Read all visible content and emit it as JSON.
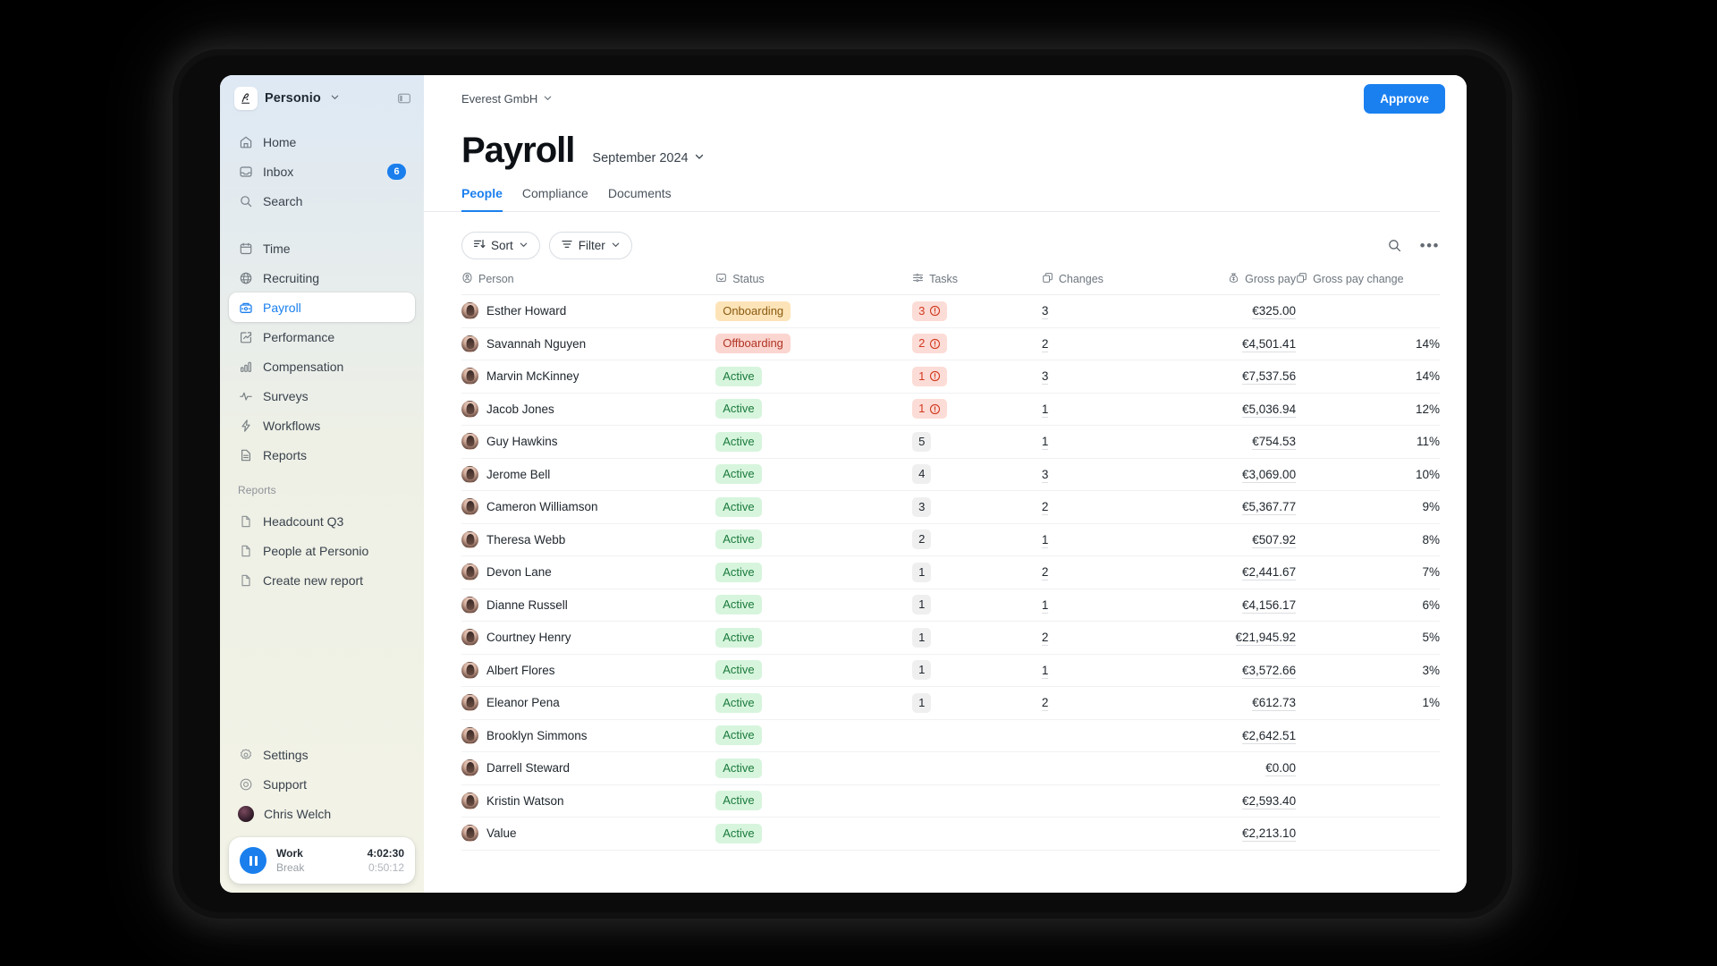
{
  "sidebar": {
    "brand": "Personio",
    "brand_logo_icon": "personio-p-logo-icon",
    "panel_toggle_icon": "panel-toggle-icon",
    "primary": [
      {
        "label": "Home",
        "icon": "home-icon"
      },
      {
        "label": "Inbox",
        "icon": "inbox-icon",
        "badge": "6"
      },
      {
        "label": "Search",
        "icon": "search-icon"
      }
    ],
    "modules": [
      {
        "label": "Time",
        "icon": "calendar-icon"
      },
      {
        "label": "Recruiting",
        "icon": "globe-icon"
      },
      {
        "label": "Payroll",
        "icon": "payroll-icon",
        "active": true
      },
      {
        "label": "Performance",
        "icon": "performance-icon"
      },
      {
        "label": "Compensation",
        "icon": "bar-chart-icon"
      },
      {
        "label": "Surveys",
        "icon": "pulse-icon"
      },
      {
        "label": "Workflows",
        "icon": "bolt-icon"
      },
      {
        "label": "Reports",
        "icon": "document-icon"
      }
    ],
    "reports_label": "Reports",
    "reports": [
      {
        "label": "Headcount Q3",
        "icon": "file-icon"
      },
      {
        "label": "People at Personio",
        "icon": "file-icon"
      },
      {
        "label": "Create new report",
        "icon": "file-icon"
      }
    ],
    "footer": [
      {
        "label": "Settings",
        "icon": "gear-icon"
      },
      {
        "label": "Support",
        "icon": "lifebuoy-icon"
      },
      {
        "label": "Chris Welch",
        "icon": "avatar"
      }
    ],
    "timer": {
      "play_pause_icon": "pause-icon",
      "work_label": "Work",
      "work_time": "4:02:30",
      "break_label": "Break",
      "break_time": "0:50:12"
    }
  },
  "header": {
    "org": "Everest GmbH",
    "org_chevron_icon": "chevron-down-icon",
    "approve_label": "Approve",
    "title": "Payroll",
    "period": "September 2024",
    "period_chevron_icon": "chevron-down-icon",
    "tabs": [
      {
        "label": "People",
        "active": true
      },
      {
        "label": "Compliance",
        "active": false
      },
      {
        "label": "Documents",
        "active": false
      }
    ]
  },
  "toolbar": {
    "sort_label": "Sort",
    "sort_icon": "sort-icon",
    "filter_label": "Filter",
    "filter_icon": "filter-icon",
    "search_icon": "search-icon",
    "more_icon": "more-horizontal-icon"
  },
  "table": {
    "columns": [
      {
        "label": "Person",
        "icon": "person-icon",
        "align": "left"
      },
      {
        "label": "Status",
        "icon": "status-icon",
        "align": "left"
      },
      {
        "label": "Tasks",
        "icon": "tasks-icon",
        "align": "left"
      },
      {
        "label": "Changes",
        "icon": "copy-icon",
        "align": "left"
      },
      {
        "label": "Gross pay",
        "icon": "money-bag-icon",
        "align": "right"
      },
      {
        "label": "Gross pay change",
        "icon": "copy-icon",
        "align": "left"
      }
    ],
    "rows": [
      {
        "person": "Esther Howard",
        "status": "Onboarding",
        "status_kind": "onboarding",
        "tasks": "3",
        "tasks_alert": true,
        "changes": "3",
        "gross": "€325.00",
        "gross_change": ""
      },
      {
        "person": "Savannah Nguyen",
        "status": "Offboarding",
        "status_kind": "offboarding",
        "tasks": "2",
        "tasks_alert": true,
        "changes": "2",
        "gross": "€4,501.41",
        "gross_change": "14%"
      },
      {
        "person": "Marvin McKinney",
        "status": "Active",
        "status_kind": "active",
        "tasks": "1",
        "tasks_alert": true,
        "changes": "3",
        "gross": "€7,537.56",
        "gross_change": "14%"
      },
      {
        "person": "Jacob Jones",
        "status": "Active",
        "status_kind": "active",
        "tasks": "1",
        "tasks_alert": true,
        "changes": "1",
        "gross": "€5,036.94",
        "gross_change": "12%"
      },
      {
        "person": "Guy Hawkins",
        "status": "Active",
        "status_kind": "active",
        "tasks": "5",
        "tasks_alert": false,
        "changes": "1",
        "gross": "€754.53",
        "gross_change": "11%"
      },
      {
        "person": "Jerome Bell",
        "status": "Active",
        "status_kind": "active",
        "tasks": "4",
        "tasks_alert": false,
        "changes": "3",
        "gross": "€3,069.00",
        "gross_change": "10%"
      },
      {
        "person": "Cameron Williamson",
        "status": "Active",
        "status_kind": "active",
        "tasks": "3",
        "tasks_alert": false,
        "changes": "2",
        "gross": "€5,367.77",
        "gross_change": "9%"
      },
      {
        "person": "Theresa Webb",
        "status": "Active",
        "status_kind": "active",
        "tasks": "2",
        "tasks_alert": false,
        "changes": "1",
        "gross": "€507.92",
        "gross_change": "8%"
      },
      {
        "person": "Devon Lane",
        "status": "Active",
        "status_kind": "active",
        "tasks": "1",
        "tasks_alert": false,
        "changes": "2",
        "gross": "€2,441.67",
        "gross_change": "7%"
      },
      {
        "person": "Dianne Russell",
        "status": "Active",
        "status_kind": "active",
        "tasks": "1",
        "tasks_alert": false,
        "changes": "1",
        "gross": "€4,156.17",
        "gross_change": "6%"
      },
      {
        "person": "Courtney Henry",
        "status": "Active",
        "status_kind": "active",
        "tasks": "1",
        "tasks_alert": false,
        "changes": "2",
        "gross": "€21,945.92",
        "gross_change": "5%"
      },
      {
        "person": "Albert Flores",
        "status": "Active",
        "status_kind": "active",
        "tasks": "1",
        "tasks_alert": false,
        "changes": "1",
        "gross": "€3,572.66",
        "gross_change": "3%"
      },
      {
        "person": "Eleanor Pena",
        "status": "Active",
        "status_kind": "active",
        "tasks": "1",
        "tasks_alert": false,
        "changes": "2",
        "gross": "€612.73",
        "gross_change": "1%"
      },
      {
        "person": "Brooklyn Simmons",
        "status": "Active",
        "status_kind": "active",
        "tasks": "",
        "tasks_alert": false,
        "changes": "",
        "gross": "€2,642.51",
        "gross_change": ""
      },
      {
        "person": "Darrell Steward",
        "status": "Active",
        "status_kind": "active",
        "tasks": "",
        "tasks_alert": false,
        "changes": "",
        "gross": "€0.00",
        "gross_change": ""
      },
      {
        "person": "Kristin Watson",
        "status": "Active",
        "status_kind": "active",
        "tasks": "",
        "tasks_alert": false,
        "changes": "",
        "gross": "€2,593.40",
        "gross_change": ""
      },
      {
        "person": "Value",
        "status": "Active",
        "status_kind": "active",
        "tasks": "",
        "tasks_alert": false,
        "changes": "",
        "gross": "€2,213.10",
        "gross_change": ""
      }
    ]
  },
  "colors": {
    "accent": "#1a7fed",
    "approve": "#1a80f0",
    "status_active_bg": "#d7f5dd",
    "status_onboarding_bg": "#fde4b8",
    "status_offboarding_bg": "#fbd5cf",
    "task_alert_bg": "#fcdcd6"
  }
}
